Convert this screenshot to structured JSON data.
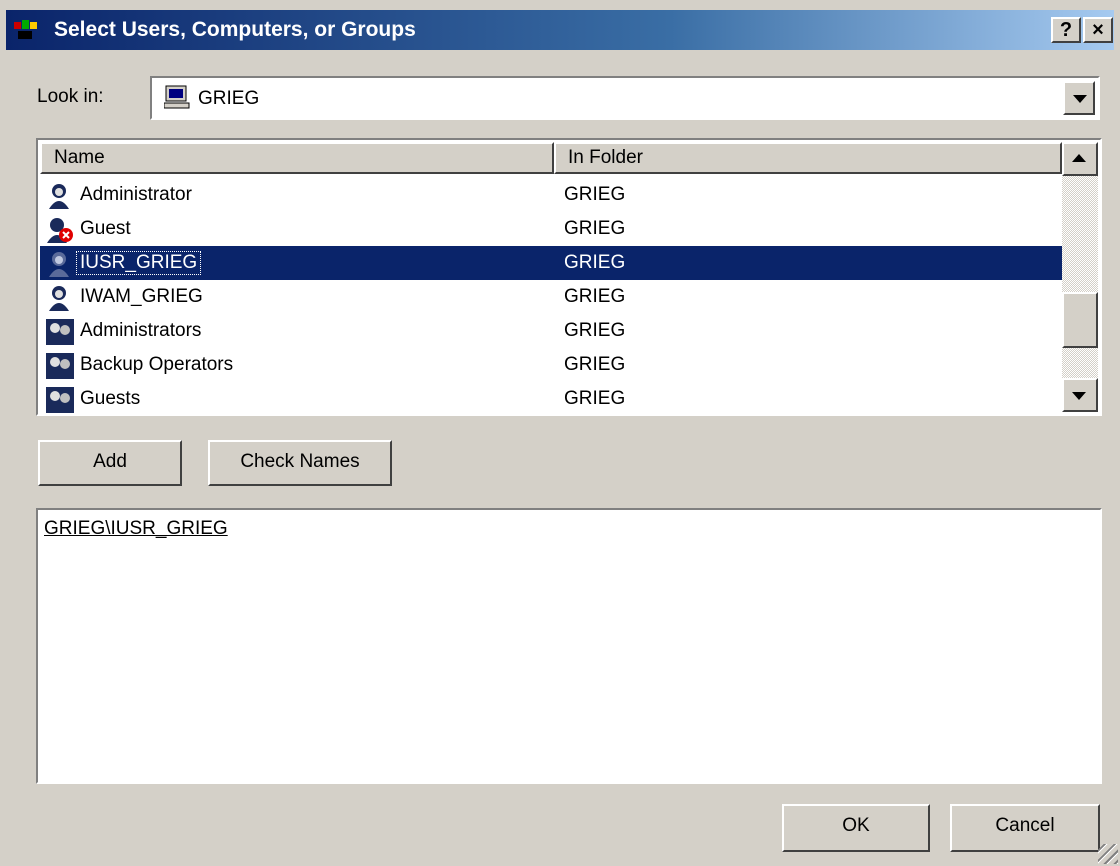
{
  "window": {
    "title": "Select Users, Computers, or Groups",
    "help_label": "?",
    "close_label": "×"
  },
  "look_in": {
    "label": "Look in:",
    "value": "GRIEG",
    "icon": "computer-icon"
  },
  "list": {
    "columns": [
      "Name",
      "In Folder"
    ],
    "rows": [
      {
        "name": "Administrator",
        "folder": "GRIEG",
        "icon": "user-icon"
      },
      {
        "name": "Guest",
        "folder": "GRIEG",
        "icon": "disabled-user-icon"
      },
      {
        "name": "IUSR_GRIEG",
        "folder": "GRIEG",
        "icon": "user-icon",
        "selected": true
      },
      {
        "name": "IWAM_GRIEG",
        "folder": "GRIEG",
        "icon": "user-icon"
      },
      {
        "name": "Administrators",
        "folder": "GRIEG",
        "icon": "group-icon"
      },
      {
        "name": "Backup Operators",
        "folder": "GRIEG",
        "icon": "group-icon"
      },
      {
        "name": "Guests",
        "folder": "GRIEG",
        "icon": "group-icon"
      }
    ]
  },
  "buttons": {
    "add": "Add",
    "check_names": "Check Names",
    "ok": "OK",
    "cancel": "Cancel"
  },
  "selected_box": {
    "entry": "GRIEG\\IUSR_GRIEG"
  },
  "colors": {
    "face": "#d4d0c8",
    "selection": "#0a246a",
    "title_start": "#0a246a",
    "title_end": "#a6caf0"
  }
}
